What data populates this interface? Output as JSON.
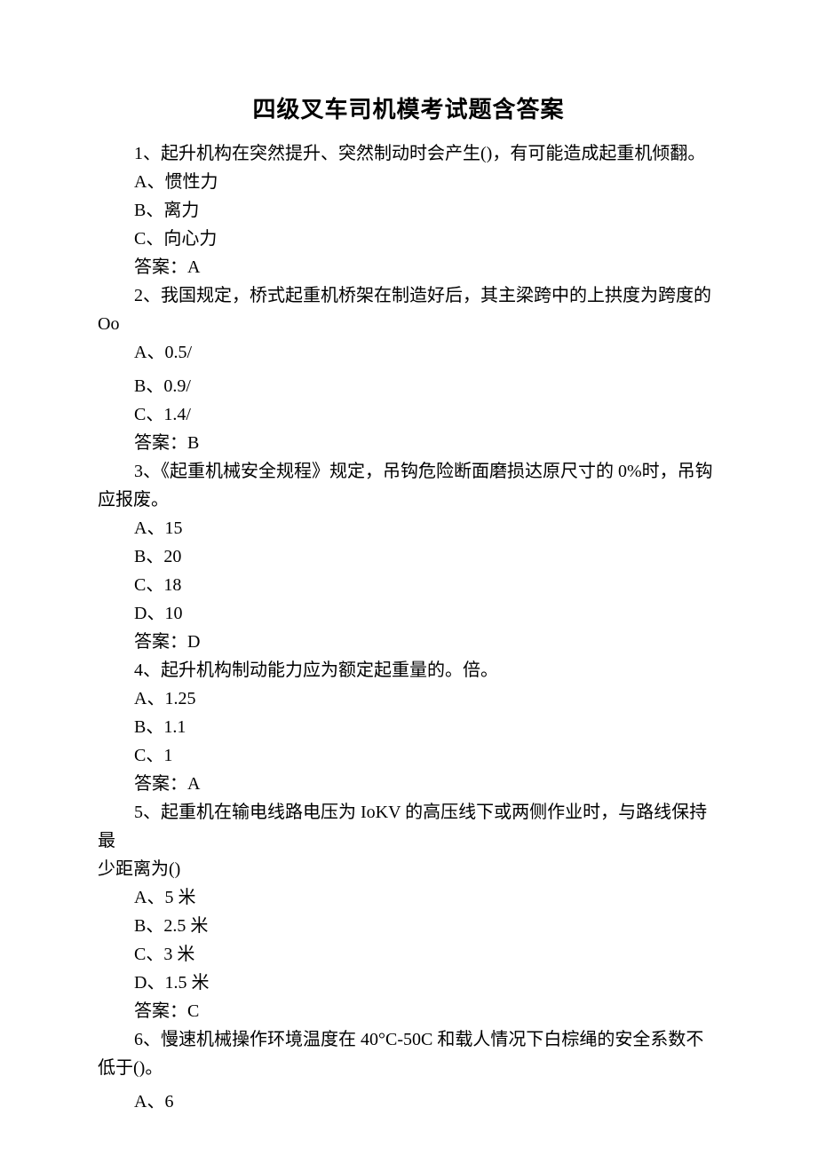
{
  "title": "四级叉车司机模考试题含答案",
  "questions": [
    {
      "stem": "1、起升机构在突然提升、突然制动时会产生()，有可能造成起重机倾翻。",
      "options": [
        "A、惯性力",
        "B、离力",
        "C、向心力"
      ],
      "answer": "答案：A"
    },
    {
      "stem_line1": "2、我国规定，桥式起重机桥架在制造好后，其主梁跨中的上拱度为跨度的",
      "stem_line2": "Oo",
      "options": [
        "A、0.5/",
        "B、0.9/",
        "C、1.4/"
      ],
      "answer": "答案：B"
    },
    {
      "stem_line1": "3、《起重机械安全规程》规定，吊钩危险断面磨损达原尺寸的 0%时，吊钩",
      "stem_line2": "应报废。",
      "options": [
        "A、15",
        "B、20",
        "C、18",
        "D、10"
      ],
      "answer": "答案：D"
    },
    {
      "stem": "4、起升机构制动能力应为额定起重量的。倍。",
      "options": [
        "A、1.25",
        "B、1.1",
        "C、1"
      ],
      "answer": "答案：A"
    },
    {
      "stem_line1": "5、起重机在输电线路电压为 IoKV 的高压线下或两侧作业时，与路线保持最",
      "stem_line2": "少距离为()",
      "options": [
        "A、5 米",
        "B、2.5 米",
        "C、3 米",
        "D、1.5 米"
      ],
      "answer": "答案：C"
    },
    {
      "stem_line1": "6、慢速机械操作环境温度在 40°C-50C 和载人情况下白棕绳的安全系数不",
      "stem_line2": "低于()。",
      "options": [
        "A、6"
      ]
    }
  ]
}
